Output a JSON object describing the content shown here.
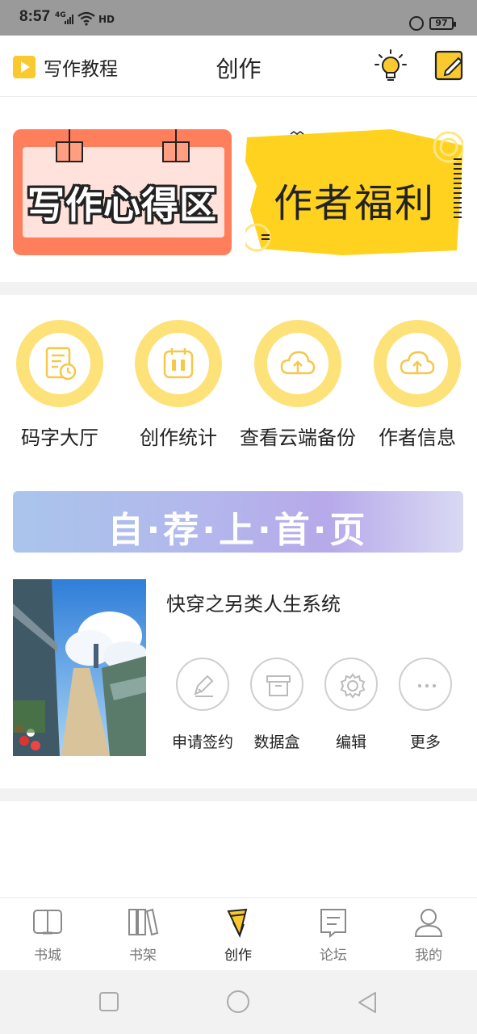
{
  "status_bar": {
    "time": "8:57",
    "network": "4G",
    "hd": "HD",
    "battery": "97"
  },
  "header": {
    "tutorial_label": "写作教程",
    "title": "创作"
  },
  "banners": {
    "left_text": "写作心得区",
    "right_text": "作者福利"
  },
  "quick_actions": [
    {
      "label": "码字大厅",
      "icon": "document-clock-icon"
    },
    {
      "label": "创作统计",
      "icon": "calendar-stats-icon"
    },
    {
      "label": "查看云端备份",
      "icon": "cloud-upload-icon"
    },
    {
      "label": "作者信息",
      "icon": "cloud-upload-icon"
    }
  ],
  "promo": {
    "text": "自·荐·上·首·页"
  },
  "book": {
    "title": "快穿之另类人生系统",
    "actions": [
      {
        "label": "申请签约",
        "icon": "pen-icon"
      },
      {
        "label": "数据盒",
        "icon": "box-icon"
      },
      {
        "label": "编辑",
        "icon": "gear-icon"
      },
      {
        "label": "更多",
        "icon": "more-icon"
      }
    ]
  },
  "bottom_nav": [
    {
      "label": "书城",
      "icon": "book-open-icon",
      "active": false
    },
    {
      "label": "书架",
      "icon": "bookshelf-icon",
      "active": false
    },
    {
      "label": "创作",
      "icon": "pen-create-icon",
      "active": true
    },
    {
      "label": "论坛",
      "icon": "forum-icon",
      "active": false
    },
    {
      "label": "我的",
      "icon": "user-icon",
      "active": false
    }
  ],
  "colors": {
    "accent": "#f9c92d",
    "banner_orange": "#ff7f5c",
    "banner_yellow": "#ffd21f",
    "divider": "#f2f2f2"
  }
}
